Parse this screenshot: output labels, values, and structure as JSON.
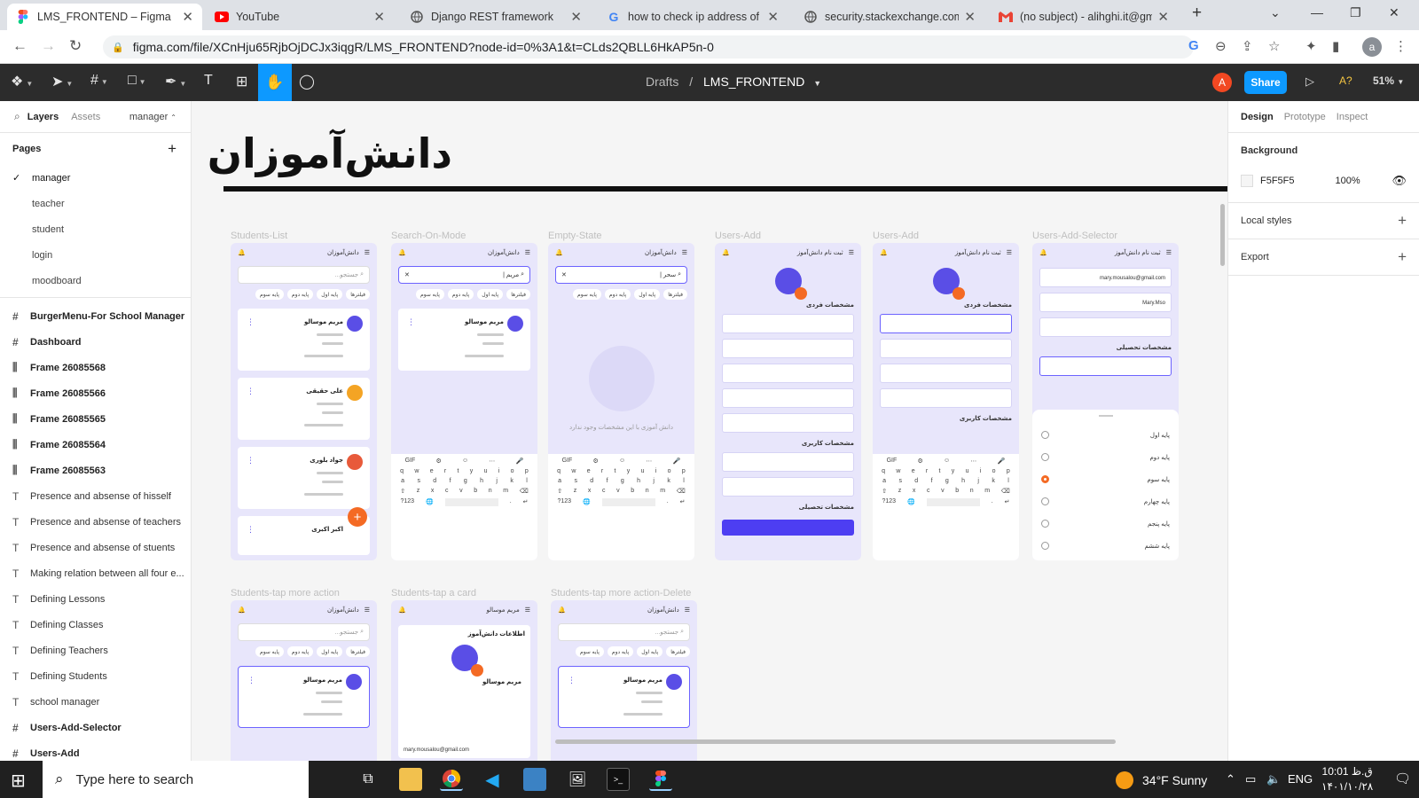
{
  "browser": {
    "tabs": [
      {
        "title": "LMS_FRONTEND – Figma",
        "icon": "figma-icon",
        "active": true
      },
      {
        "title": "YouTube",
        "icon": "youtube-icon",
        "active": false
      },
      {
        "title": "Django REST framework",
        "icon": "globe-icon",
        "active": false
      },
      {
        "title": "how to check ip address of w",
        "icon": "google-icon",
        "active": false
      },
      {
        "title": "security.stackexchange.com",
        "icon": "globe-icon",
        "active": false
      },
      {
        "title": "(no subject) - alihghi.it@gma",
        "icon": "gmail-icon",
        "active": false
      }
    ],
    "url": "figma.com/file/XCnHju65RjbOjDCJx3iqgR/LMS_FRONTEND?node-id=0%3A1&t=CLds2QBLL6HkAP5n-0",
    "profile_initial": "a"
  },
  "figma": {
    "breadcrumb_parent": "Drafts",
    "breadcrumb_sep": "/",
    "file_name": "LMS_FRONTEND",
    "user_initial": "A",
    "share_label": "Share",
    "font_warning": "A?",
    "zoom": "51%"
  },
  "left_panel": {
    "tab_layers": "Layers",
    "tab_assets": "Assets",
    "page_selector": "manager",
    "pages_title": "Pages",
    "pages": [
      "manager",
      "teacher",
      "student",
      "login",
      "moodboard"
    ],
    "current_page": "manager",
    "layers": [
      {
        "name": "BurgerMenu-For School Manager",
        "kind": "frame"
      },
      {
        "name": "Dashboard",
        "kind": "frame"
      },
      {
        "name": "Frame 26085568",
        "kind": "autolayout"
      },
      {
        "name": "Frame 26085566",
        "kind": "autolayout"
      },
      {
        "name": "Frame 26085565",
        "kind": "autolayout"
      },
      {
        "name": "Frame 26085564",
        "kind": "autolayout"
      },
      {
        "name": "Frame 26085563",
        "kind": "autolayout"
      },
      {
        "name": "Presence and absense of hisself",
        "kind": "text"
      },
      {
        "name": "Presence and absense of teachers",
        "kind": "text"
      },
      {
        "name": "Presence and absense of stuents",
        "kind": "text"
      },
      {
        "name": "Making relation between all four e...",
        "kind": "text"
      },
      {
        "name": "Defining Lessons",
        "kind": "text"
      },
      {
        "name": "Defining Classes",
        "kind": "text"
      },
      {
        "name": "Defining Teachers",
        "kind": "text"
      },
      {
        "name": "Defining Students",
        "kind": "text"
      },
      {
        "name": "school manager",
        "kind": "text"
      },
      {
        "name": "Users-Add-Selector",
        "kind": "frame"
      },
      {
        "name": "Users-Add",
        "kind": "frame"
      }
    ]
  },
  "canvas": {
    "page_heading": "دانش‌آموزان",
    "frame_labels": [
      "Students-List",
      "Search-On-Mode",
      "Empty-State",
      "Users-Add",
      "Users-Add",
      "Users-Add-Selector",
      "Students-tap more action",
      "Students-tap a card",
      "Students-tap more action-Delete"
    ],
    "app_title": "دانش‌آموزان",
    "register_title": "ثبت نام دانش‌آموز",
    "search_placeholder": "جستجو...",
    "search_query_1": "مریم |",
    "search_query_2": "سحر |",
    "chips": [
      "فیلترها",
      "پایه اول",
      "پایه دوم",
      "پایه سوم"
    ],
    "students": [
      "مریم موسالو",
      "علی حقیقی",
      "جواد بلوری",
      "اکبر اکبری"
    ],
    "empty_text": "دانش آموزی با این مشخصات وجود ندارد",
    "section_personal": "مشخصات فردی",
    "section_user": "مشخصات کاربری",
    "section_education": "مشخصات تحصیلی",
    "detail_title": "اطلاعات دانش‌آموز",
    "detail_email": "mary.mousalou@gmail.com",
    "selector_email": "mary.mousalou@gmail.com",
    "selector_username": "Mary.Mso",
    "grades": [
      "پایه اول",
      "پایه دوم",
      "پایه سوم",
      "پایه چهارم",
      "پایه پنجم",
      "پایه ششم"
    ],
    "selected_grade_index": 2
  },
  "right_panel": {
    "tabs": [
      "Design",
      "Prototype",
      "Inspect"
    ],
    "active_tab": "Design",
    "background_title": "Background",
    "background_hex": "F5F5F5",
    "background_opacity": "100%",
    "local_styles": "Local styles",
    "export": "Export"
  },
  "taskbar": {
    "search_placeholder": "Type here to search",
    "weather": "34°F  Sunny",
    "lang": "ENG",
    "time": "10:01 ق.ظ",
    "date": "۱۴۰۱/۱۰/۲۸"
  },
  "colors": {
    "figma_blue": "#0d99ff",
    "toolbar_bg": "#2c2c2c",
    "canvas_bg": "#F5F5F5",
    "accent_purple": "#4d3ef2",
    "accent_orange": "#f46a24"
  }
}
